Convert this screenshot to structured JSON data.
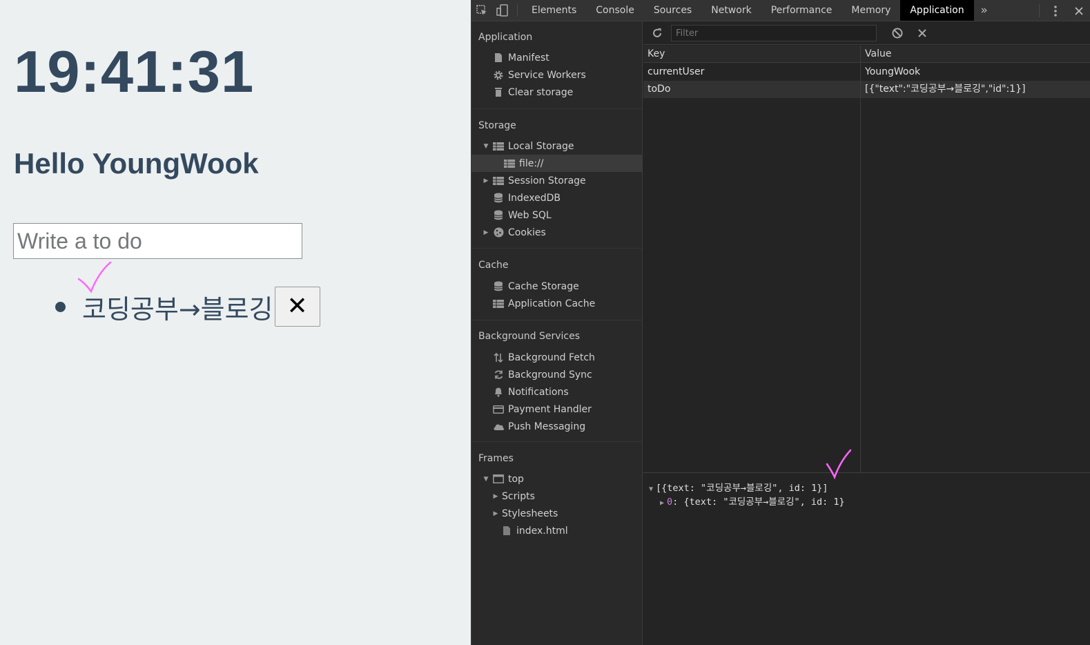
{
  "app": {
    "clock": "19:41:31",
    "greeting": "Hello YoungWook",
    "input_placeholder": "Write a to do",
    "todos": [
      {
        "text": "코딩공부→블로깅",
        "delete_label": "✕"
      }
    ]
  },
  "devtools": {
    "tabs": [
      "Elements",
      "Console",
      "Sources",
      "Network",
      "Performance",
      "Memory",
      "Application"
    ],
    "active_tab": "Application",
    "sidebar": {
      "application_title": "Application",
      "application_items": [
        "Manifest",
        "Service Workers",
        "Clear storage"
      ],
      "storage_title": "Storage",
      "storage_items": [
        "Local Storage",
        "file://",
        "Session Storage",
        "IndexedDB",
        "Web SQL",
        "Cookies"
      ],
      "cache_title": "Cache",
      "cache_items": [
        "Cache Storage",
        "Application Cache"
      ],
      "bg_title": "Background Services",
      "bg_items": [
        "Background Fetch",
        "Background Sync",
        "Notifications",
        "Payment Handler",
        "Push Messaging"
      ],
      "frames_title": "Frames",
      "frames_items": [
        "top",
        "Scripts",
        "Stylesheets",
        "index.html"
      ]
    },
    "filter_placeholder": "Filter",
    "table": {
      "headers": {
        "key": "Key",
        "value": "Value"
      },
      "rows": [
        {
          "key": "currentUser",
          "value": "YoungWook"
        },
        {
          "key": "toDo",
          "value": "[{\"text\":\"코딩공부→블로깅\",\"id\":1}]"
        }
      ]
    },
    "console": {
      "line1": "[{text: \"코딩공부→블로깅\", id: 1}]",
      "line2_index": "0",
      "line2_rest": ": {text: \"코딩공부→블로깅\", id: 1}"
    }
  },
  "colors": {
    "app_bg": "#ecf0f1",
    "app_text": "#34495e",
    "annotation": "#ff66ff",
    "devtools_bg": "#242424",
    "active_tab_bg": "#000000"
  }
}
